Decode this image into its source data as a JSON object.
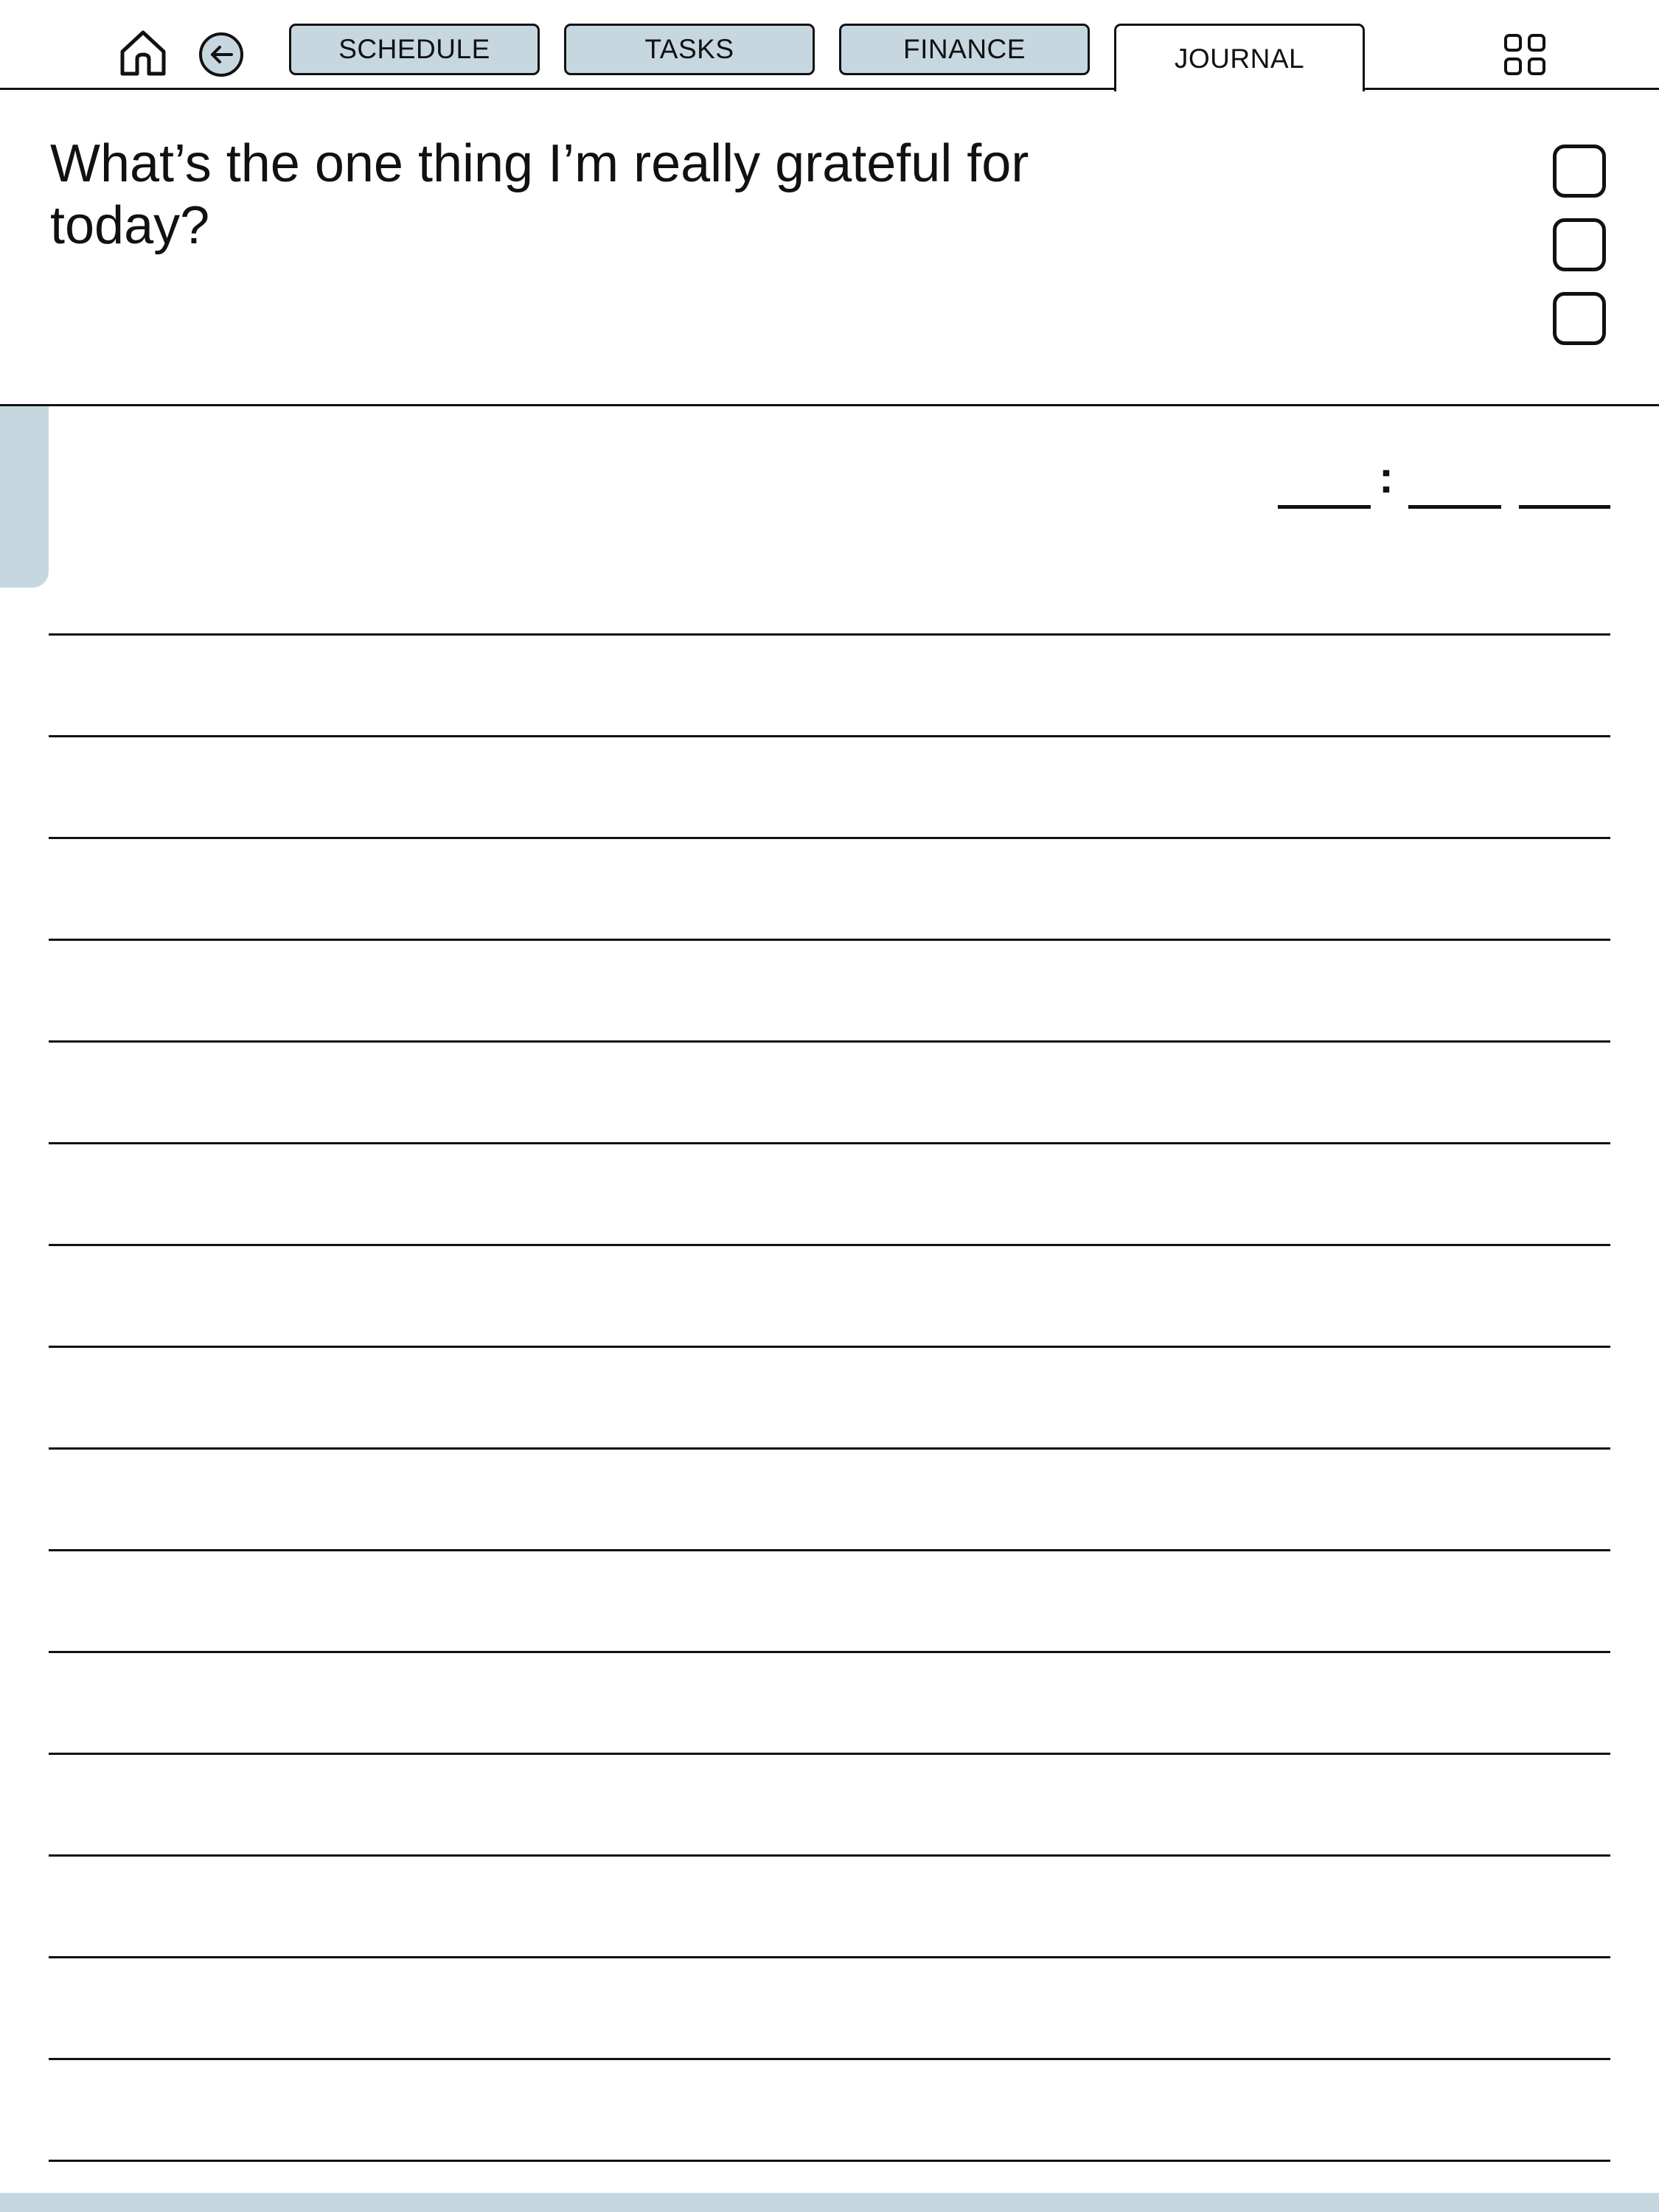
{
  "nav": {
    "tabs": [
      {
        "label": "SCHEDULE",
        "active": false
      },
      {
        "label": "TASKS",
        "active": false
      },
      {
        "label": "FINANCE",
        "active": false
      },
      {
        "label": "JOURNAL",
        "active": true
      }
    ],
    "icons": {
      "home": "home-icon",
      "back": "arrow-left-circle-icon",
      "menu": "grid-icon"
    }
  },
  "prompt": {
    "question": "What’s the one thing I’m really grateful for today?"
  },
  "time_entry": {
    "separator": ":"
  },
  "colors": {
    "accent": "#c6d7e0",
    "ink": "#111111",
    "paper": "#ffffff"
  },
  "writing_lines": {
    "count": 16
  }
}
